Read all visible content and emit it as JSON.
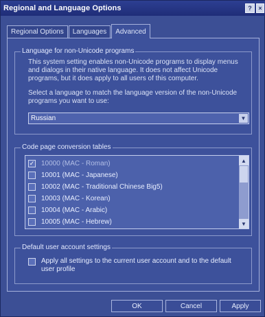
{
  "window": {
    "title": "Regional and Language Options"
  },
  "titlebar": {
    "help_glyph": "?",
    "close_glyph": "×"
  },
  "tabs": [
    {
      "label": "Regional Options"
    },
    {
      "label": "Languages"
    },
    {
      "label": "Advanced"
    }
  ],
  "nonunicode": {
    "group_label": "Language for non-Unicode programs",
    "description": "This system setting enables non-Unicode programs to display menus and dialogs in their native language. It does not affect Unicode programs, but it does apply to all users of this computer.",
    "select_prompt": "Select a language to match the language version of the non-Unicode programs you want to use:",
    "selected_language": "Russian"
  },
  "codepages": {
    "group_label": "Code page conversion tables",
    "items": [
      {
        "label": "10000 (MAC - Roman)",
        "checked": true,
        "greyed": true
      },
      {
        "label": "10001 (MAC - Japanese)",
        "checked": false
      },
      {
        "label": "10002 (MAC - Traditional Chinese Big5)",
        "checked": false
      },
      {
        "label": "10003 (MAC - Korean)",
        "checked": false
      },
      {
        "label": "10004 (MAC - Arabic)",
        "checked": false
      },
      {
        "label": "10005 (MAC - Hebrew)",
        "checked": false
      }
    ]
  },
  "defaults": {
    "group_label": "Default user account settings",
    "apply_label": "Apply all settings to the current user account and to the default user profile",
    "apply_checked": false
  },
  "buttons": {
    "ok": "OK",
    "cancel": "Cancel",
    "apply": "Apply"
  }
}
